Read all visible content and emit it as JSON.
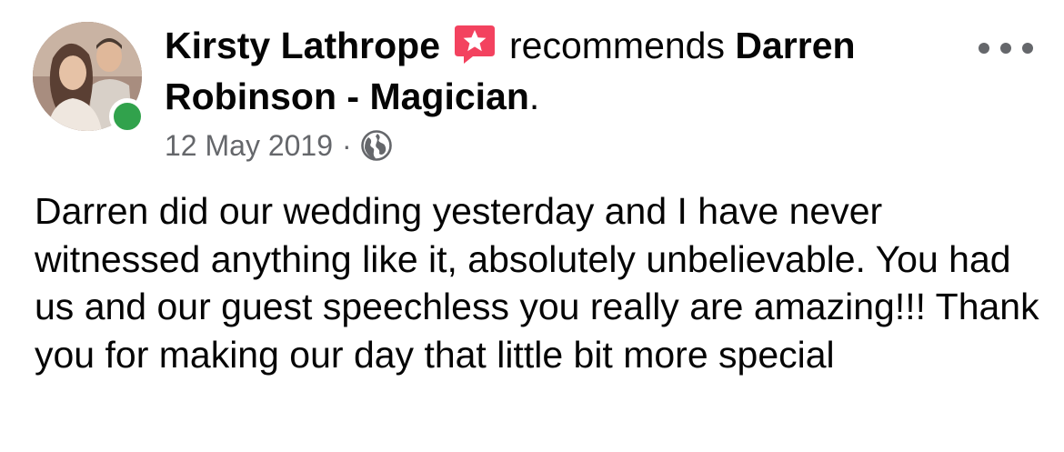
{
  "post": {
    "author": "Kirsty Lathrope",
    "verb": "recommends",
    "page": "Darren Robinson - Magician",
    "page_suffix": ".",
    "date": "12 May 2019",
    "separator": "·",
    "privacy_icon": "globe-icon",
    "recommend_icon": "recommendation-star-icon",
    "more_icon": "more-options-icon",
    "body": "Darren did our wedding yesterday and I have never witnessed anything like it, absolutely unbelievable. You had us and our guest speechless you really are amazing!!! Thank you for making our day that little bit more special",
    "online": true
  },
  "colors": {
    "text": "#050505",
    "secondary": "#65676b",
    "online_green": "#31a24c",
    "recommend_pink": "#f3425f"
  }
}
